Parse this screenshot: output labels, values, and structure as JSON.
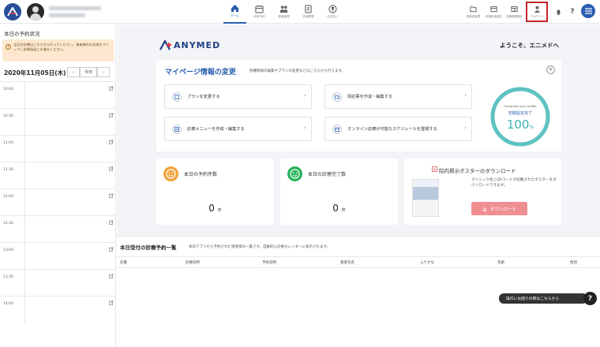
{
  "header": {
    "nav": [
      {
        "label": "ホーム",
        "icon": "home-icon",
        "active": true
      },
      {
        "label": "診療予約",
        "icon": "calendar-icon",
        "active": false
      },
      {
        "label": "患者管理",
        "icon": "users-icon",
        "active": false
      },
      {
        "label": "診療履歴",
        "icon": "history-icon",
        "active": false
      },
      {
        "label": "お支払い",
        "icon": "payment-icon",
        "active": false
      }
    ],
    "right": [
      {
        "label": "院設定管理",
        "icon": "folder-icon"
      },
      {
        "label": "診療料金設定",
        "icon": "price-icon"
      },
      {
        "label": "診療時間設定",
        "icon": "clock-calendar-icon"
      },
      {
        "label": "アカウント",
        "icon": "account-icon"
      }
    ]
  },
  "left": {
    "title": "本日の予約状況",
    "notice": "当日の診療はこちらから行ってください。患者様のお名前をクリックし診療画面にお進みください。",
    "date": "2020年11月05日(木)",
    "today_label": "今日",
    "prev": "‹",
    "next": "›",
    "times": [
      "10:00",
      "10:30",
      "11:00",
      "11:30",
      "12:00",
      "12:30",
      "13:00",
      "13:30",
      "14:00"
    ]
  },
  "main": {
    "brand": "ANYMED",
    "welcome": "ようこそ、エニメドへ",
    "mypage": {
      "title": "マイページ情報の変更",
      "subtitle": "各種情報の編集やプランの変更などはこちらから行えます。",
      "close": "×",
      "actions": [
        {
          "label": "プランを変更する"
        },
        {
          "label": "問診票を作成・編集する"
        },
        {
          "label": "診療メニューを作成・編集する"
        },
        {
          "label": "オンライン診療が可能なスケジュールを登録する"
        }
      ],
      "profile": {
        "line1": "Complete your profile",
        "line2": "初期設定完了",
        "value": "100",
        "unit": "%",
        "progress": 1.0
      }
    },
    "stats": [
      {
        "label": "本日の予約件数",
        "value": "0",
        "unit": "件",
        "color": "#f0a33a"
      },
      {
        "label": "本日の診察完了数",
        "value": "0",
        "unit": "件",
        "color": "#27b35a"
      }
    ],
    "poster": {
      "title": "院内掲示ポスターのダウンロード",
      "description": "クリニック名とQRコードが記載されたポスターをダウンロードできます。",
      "button": "ダウンロード"
    },
    "list": {
      "title": "本日受付の診療予約一覧",
      "subtitle": "本日アプリから予約された患者様の一覧です。自動的に診療カレンダーに表示されます。",
      "columns": [
        "診番",
        "診療日時",
        "予約日時",
        "患者氏名",
        "ふりがな",
        "年齢",
        "性別"
      ]
    },
    "help": {
      "label": "操作にお困りの際はこちらから",
      "icon": "?"
    }
  },
  "colors": {
    "primary": "#2a5db0",
    "brand": "#1f3f84",
    "highlight": "#c4242b",
    "teal": "#3fb3b3"
  }
}
